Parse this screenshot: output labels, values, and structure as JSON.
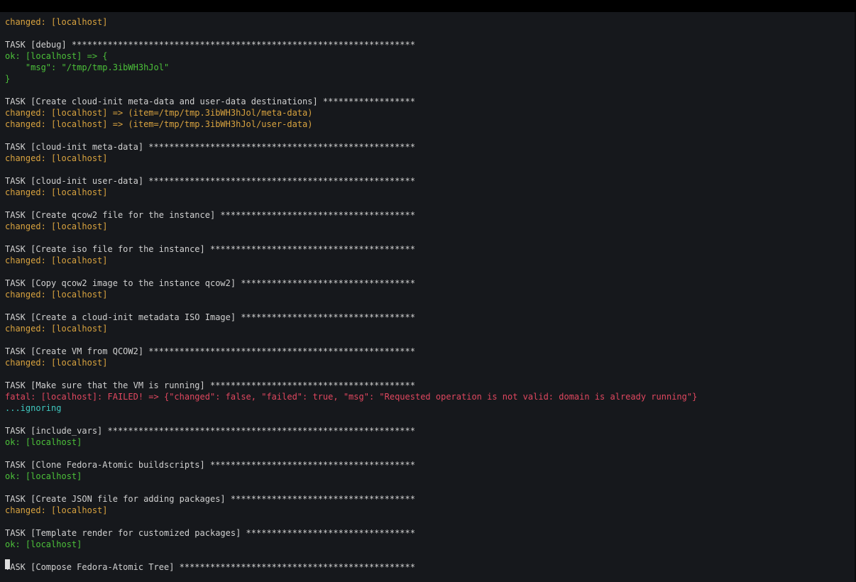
{
  "terminal": {
    "lines": [
      {
        "text": "changed: [localhost]",
        "type": "changed"
      },
      {
        "text": "",
        "type": "blank"
      },
      {
        "text": "TASK [debug] *******************************************************************",
        "type": "task"
      },
      {
        "text": "ok: [localhost] => {",
        "type": "ok"
      },
      {
        "text": "    \"msg\": \"/tmp/tmp.3ibWH3hJol\"",
        "type": "ok"
      },
      {
        "text": "}",
        "type": "ok"
      },
      {
        "text": "",
        "type": "blank"
      },
      {
        "text": "TASK [Create cloud-init meta-data and user-data destinations] ******************",
        "type": "task"
      },
      {
        "text": "changed: [localhost] => (item=/tmp/tmp.3ibWH3hJol/meta-data)",
        "type": "changed"
      },
      {
        "text": "changed: [localhost] => (item=/tmp/tmp.3ibWH3hJol/user-data)",
        "type": "changed"
      },
      {
        "text": "",
        "type": "blank"
      },
      {
        "text": "TASK [cloud-init meta-data] ****************************************************",
        "type": "task"
      },
      {
        "text": "changed: [localhost]",
        "type": "changed"
      },
      {
        "text": "",
        "type": "blank"
      },
      {
        "text": "TASK [cloud-init user-data] ****************************************************",
        "type": "task"
      },
      {
        "text": "changed: [localhost]",
        "type": "changed"
      },
      {
        "text": "",
        "type": "blank"
      },
      {
        "text": "TASK [Create qcow2 file for the instance] **************************************",
        "type": "task"
      },
      {
        "text": "changed: [localhost]",
        "type": "changed"
      },
      {
        "text": "",
        "type": "blank"
      },
      {
        "text": "TASK [Create iso file for the instance] ****************************************",
        "type": "task"
      },
      {
        "text": "changed: [localhost]",
        "type": "changed"
      },
      {
        "text": "",
        "type": "blank"
      },
      {
        "text": "TASK [Copy qcow2 image to the instance qcow2] **********************************",
        "type": "task"
      },
      {
        "text": "changed: [localhost]",
        "type": "changed"
      },
      {
        "text": "",
        "type": "blank"
      },
      {
        "text": "TASK [Create a cloud-init metadata ISO Image] **********************************",
        "type": "task"
      },
      {
        "text": "changed: [localhost]",
        "type": "changed"
      },
      {
        "text": "",
        "type": "blank"
      },
      {
        "text": "TASK [Create VM from QCOW2] ****************************************************",
        "type": "task"
      },
      {
        "text": "changed: [localhost]",
        "type": "changed"
      },
      {
        "text": "",
        "type": "blank"
      },
      {
        "text": "TASK [Make sure that the VM is running] ****************************************",
        "type": "task"
      },
      {
        "text": "fatal: [localhost]: FAILED! => {\"changed\": false, \"failed\": true, \"msg\": \"Requested operation is not valid: domain is already running\"}",
        "type": "fatal"
      },
      {
        "text": "...ignoring",
        "type": "ignoring"
      },
      {
        "text": "",
        "type": "blank"
      },
      {
        "text": "TASK [include_vars] ************************************************************",
        "type": "task"
      },
      {
        "text": "ok: [localhost]",
        "type": "ok"
      },
      {
        "text": "",
        "type": "blank"
      },
      {
        "text": "TASK [Clone Fedora-Atomic buildscripts] ****************************************",
        "type": "task"
      },
      {
        "text": "ok: [localhost]",
        "type": "ok"
      },
      {
        "text": "",
        "type": "blank"
      },
      {
        "text": "TASK [Create JSON file for adding packages] ************************************",
        "type": "task"
      },
      {
        "text": "changed: [localhost]",
        "type": "changed"
      },
      {
        "text": "",
        "type": "blank"
      },
      {
        "text": "TASK [Template render for customized packages] *********************************",
        "type": "task"
      },
      {
        "text": "ok: [localhost]",
        "type": "ok"
      },
      {
        "text": "",
        "type": "blank"
      },
      {
        "text": "TASK [Compose Fedora-Atomic Tree] **********************************************",
        "type": "task"
      }
    ]
  }
}
